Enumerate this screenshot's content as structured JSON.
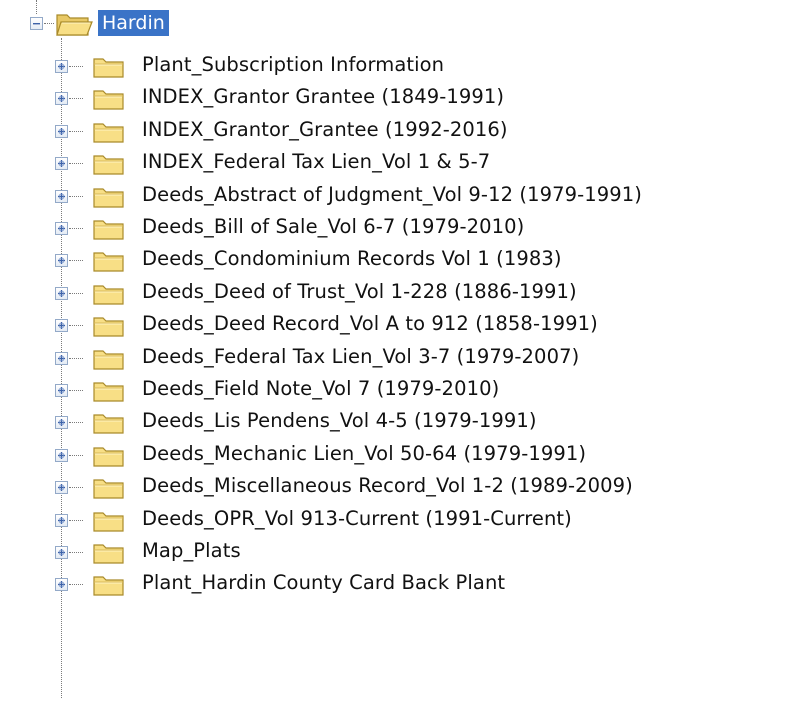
{
  "root": {
    "label": "Hardin",
    "expander_state": "expanded",
    "selected": true
  },
  "children": [
    {
      "label": "Plant_Subscription Information"
    },
    {
      "label": "INDEX_Grantor Grantee (1849-1991)"
    },
    {
      "label": "INDEX_Grantor_Grantee (1992-2016)"
    },
    {
      "label": "INDEX_Federal Tax Lien_Vol 1 & 5-7"
    },
    {
      "label": "Deeds_Abstract of Judgment_Vol 9-12 (1979-1991)"
    },
    {
      "label": "Deeds_Bill of Sale_Vol 6-7 (1979-2010)"
    },
    {
      "label": "Deeds_Condominium Records Vol 1 (1983)"
    },
    {
      "label": "Deeds_Deed of Trust_Vol 1-228 (1886-1991)"
    },
    {
      "label": "Deeds_Deed Record_Vol A to 912 (1858-1991)"
    },
    {
      "label": "Deeds_Federal Tax Lien_Vol 3-7 (1979-2007)"
    },
    {
      "label": "Deeds_Field Note_Vol 7 (1979-2010)"
    },
    {
      "label": "Deeds_Lis Pendens_Vol 4-5 (1979-1991)"
    },
    {
      "label": "Deeds_Mechanic Lien_Vol 50-64 (1979-1991)"
    },
    {
      "label": "Deeds_Miscellaneous Record_Vol 1-2 (1989-2009)"
    },
    {
      "label": "Deeds_OPR_Vol 913-Current (1991-Current)"
    },
    {
      "label": "Map_Plats"
    },
    {
      "label": "Plant_Hardin County Card Back Plant"
    }
  ],
  "child_expander_state": "collapsed",
  "colors": {
    "selection_bg": "#3a73c7",
    "selection_text": "#ffffff",
    "folder_fill": "#f8df86",
    "folder_outline": "#a98a2a",
    "expander_border": "#93a9c8",
    "expander_glyph": "#3d62a8",
    "text": "#111111"
  },
  "icons": {
    "root_expander": "collapse-minus-icon",
    "root_folder": "folder-open-icon",
    "child_expander": "expand-plus-icon",
    "child_folder": "folder-closed-icon"
  }
}
